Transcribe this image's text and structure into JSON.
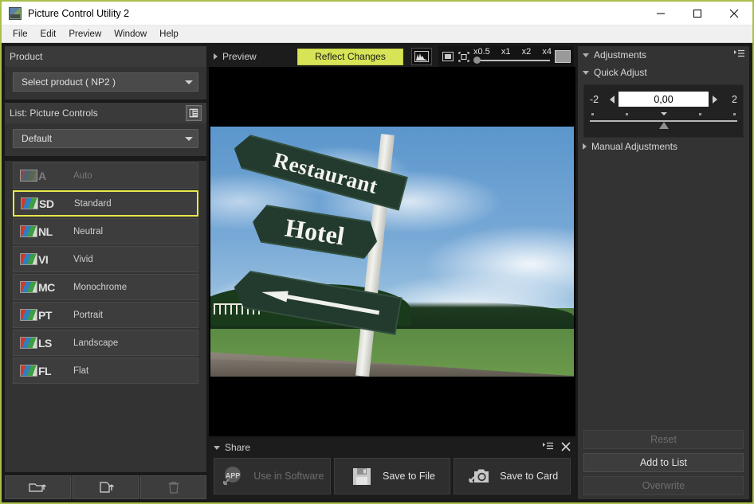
{
  "window": {
    "title": "Picture Control Utility 2",
    "app_icon": "picture-control-icon",
    "minimize": "minimize-icon",
    "maximize": "maximize-icon",
    "close": "close-icon",
    "border_color": "#a8bf4a"
  },
  "menubar": {
    "items": [
      {
        "label": "File"
      },
      {
        "label": "Edit"
      },
      {
        "label": "Preview"
      },
      {
        "label": "Window"
      },
      {
        "label": "Help"
      }
    ]
  },
  "left": {
    "product": {
      "header": "Product",
      "combo_value": "Select product ( NP2 )",
      "caret_icon": "chevron-down-icon"
    },
    "list_section": {
      "header": "List: Picture Controls",
      "header_icon": "list-details-icon",
      "combo_value": "Default",
      "caret_icon": "chevron-down-icon",
      "items": [
        {
          "code": "A",
          "label": "Auto",
          "selected": false,
          "enabled": false
        },
        {
          "code": "SD",
          "label": "Standard",
          "selected": true,
          "enabled": true
        },
        {
          "code": "NL",
          "label": "Neutral",
          "selected": false,
          "enabled": true
        },
        {
          "code": "VI",
          "label": "Vivid",
          "selected": false,
          "enabled": true
        },
        {
          "code": "MC",
          "label": "Monochrome",
          "selected": false,
          "enabled": true
        },
        {
          "code": "PT",
          "label": "Portrait",
          "selected": false,
          "enabled": true
        },
        {
          "code": "LS",
          "label": "Landscape",
          "selected": false,
          "enabled": true
        },
        {
          "code": "FL",
          "label": "Flat",
          "selected": false,
          "enabled": true
        }
      ]
    },
    "tools": [
      {
        "icon": "folder-import-icon",
        "enabled": true
      },
      {
        "icon": "file-export-icon",
        "enabled": true
      },
      {
        "icon": "trash-icon",
        "enabled": false
      }
    ]
  },
  "center": {
    "preview": {
      "header": "Preview",
      "collapse_icon": "chevron-right-icon",
      "reflect_button": "Reflect Changes",
      "reflect_color": "#d6e456",
      "histogram_icon": "histogram-icon",
      "fit_icon": "fit-to-window-icon",
      "crop_icon": "crop-icon",
      "fullscreen_icon": "fullscreen-icon",
      "zoom_levels": [
        "x0.5",
        "x1",
        "x2",
        "x4"
      ],
      "zoom_selected": "x0.5"
    },
    "photo": {
      "sign_top": "Restaurant",
      "sign_middle": "Hotel",
      "sign_bottom": "arrow-left-sign"
    },
    "share": {
      "header": "Share",
      "collapse_icon": "chevron-down-icon",
      "menu_icon": "panel-menu-icon",
      "close_icon": "close-icon",
      "buttons": [
        {
          "label": "Use in Software",
          "icon": "app-share-icon",
          "enabled": false
        },
        {
          "label": "Save to File",
          "icon": "floppy-disk-icon",
          "enabled": true
        },
        {
          "label": "Save to Card",
          "icon": "camera-icon",
          "enabled": true
        }
      ]
    }
  },
  "right": {
    "adjustments": {
      "header": "Adjustments",
      "menu_icon": "panel-menu-icon",
      "collapse_icon": "chevron-down-icon"
    },
    "quick_adjust": {
      "header": "Quick Adjust",
      "collapse_icon": "chevron-down-icon",
      "min": "-2",
      "max": "2",
      "value": "0,00",
      "dec_icon": "spinner-left-icon",
      "inc_icon": "spinner-right-icon"
    },
    "manual_adjustments": {
      "header": "Manual Adjustments",
      "collapse_icon": "chevron-right-icon"
    },
    "buttons": [
      {
        "label": "Reset",
        "enabled": false
      },
      {
        "label": "Add to List",
        "enabled": true
      },
      {
        "label": "Overwrite",
        "enabled": false
      }
    ]
  }
}
